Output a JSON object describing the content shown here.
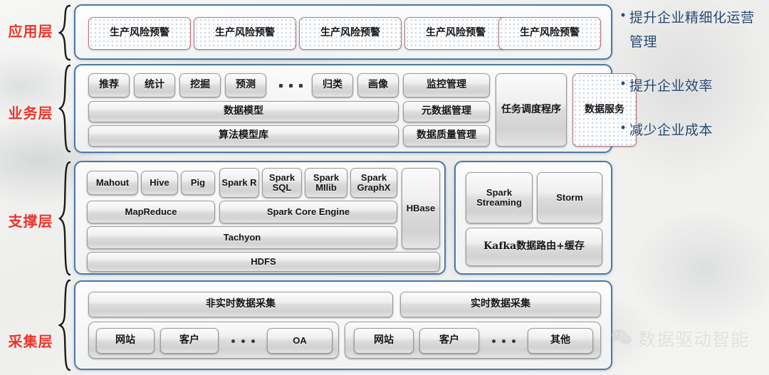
{
  "layers": [
    {
      "id": "application",
      "label": "应用层"
    },
    {
      "id": "business",
      "label": "业务层"
    },
    {
      "id": "support",
      "label": "支撑层"
    },
    {
      "id": "collection",
      "label": "采集层"
    }
  ],
  "application_layer": {
    "boxes": [
      {
        "label": "生产风险预警"
      },
      {
        "label": "生产风险预警"
      },
      {
        "label": "生产风险预警"
      },
      {
        "label": "生产风险预警"
      },
      {
        "label": "生产风险预警"
      }
    ]
  },
  "business_layer": {
    "top_row": [
      {
        "label": "推荐"
      },
      {
        "label": "统计"
      },
      {
        "label": "挖掘"
      },
      {
        "label": "预测"
      },
      {
        "label": "归类"
      },
      {
        "label": "画像"
      }
    ],
    "ellipsis": "· · ·",
    "stack_left": [
      {
        "label": "数据模型"
      },
      {
        "label": "算法模型库"
      }
    ],
    "stack_right": [
      {
        "label": "监控管理"
      },
      {
        "label": "元数据管理"
      },
      {
        "label": "数据质量管理"
      }
    ],
    "scheduler": {
      "label": "任务调度程序"
    },
    "data_service": {
      "label": "数据服务"
    }
  },
  "support_layer": {
    "batch_top_row": [
      {
        "label": "Mahout"
      },
      {
        "label": "Hive"
      },
      {
        "label": "Pig"
      },
      {
        "label": "Spark R"
      },
      {
        "label": "Spark SQL"
      },
      {
        "label": "Spark MIlib"
      },
      {
        "label": "Spark GraphX"
      }
    ],
    "engine_row": [
      {
        "label": "MapReduce"
      },
      {
        "label": "Spark Core Engine"
      }
    ],
    "hbase": {
      "label": "HBase"
    },
    "tachyon": {
      "label": "Tachyon"
    },
    "hdfs": {
      "label": "HDFS"
    },
    "streaming": [
      {
        "label": "Spark Streaming"
      },
      {
        "label": "Storm"
      }
    ],
    "kafka": {
      "label": "Kafka数据路由+缓存"
    }
  },
  "collection_layer": {
    "non_realtime": {
      "label": "非实时数据采集"
    },
    "realtime": {
      "label": "实时数据采集"
    },
    "non_realtime_sources": [
      {
        "label": "网站"
      },
      {
        "label": "客户"
      },
      {
        "label": "OA"
      }
    ],
    "realtime_sources": [
      {
        "label": "网站"
      },
      {
        "label": "客户"
      },
      {
        "label": "其他"
      }
    ],
    "ellipsis": "· · ·"
  },
  "benefits": [
    {
      "bullet": "•",
      "text": "提升企业精细化运营管理"
    },
    {
      "bullet": "•",
      "text": "提升企业效率"
    },
    {
      "bullet": "•",
      "text": "减少企业成本"
    }
  ],
  "watermark": {
    "icon": "wechat-icon",
    "text": "数据驱动智能"
  },
  "colors": {
    "layer_label": "#e8342a",
    "container_border": "#4a77a8",
    "highlight_border": "#b9737c",
    "benefit_text": "#23466f"
  }
}
